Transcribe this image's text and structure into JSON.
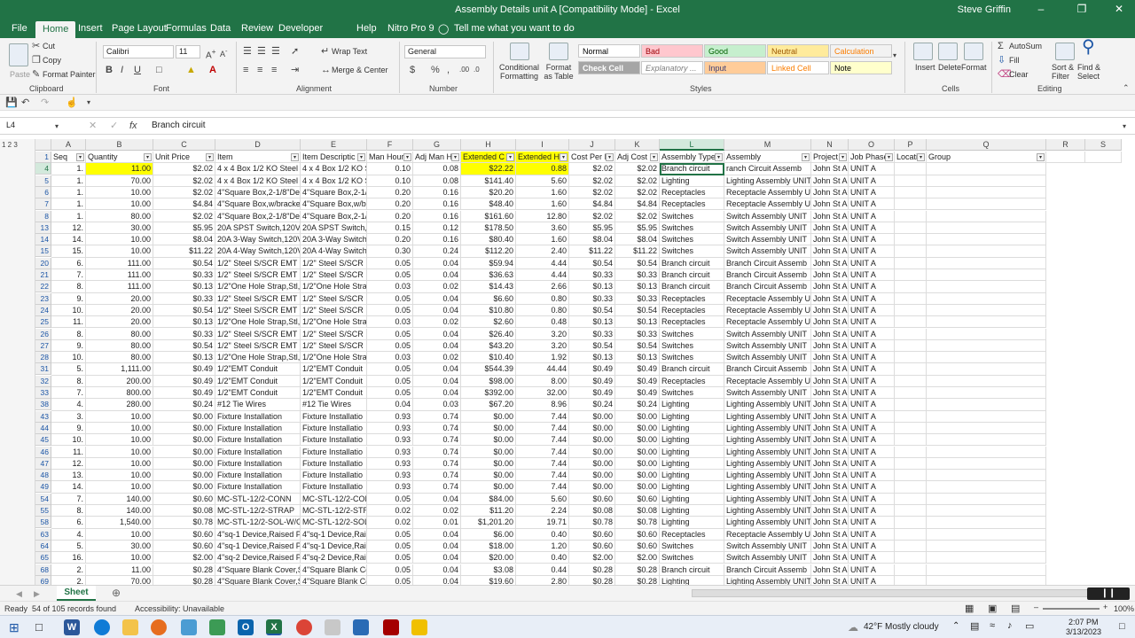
{
  "window": {
    "title": "Assembly Details unit A  [Compatibility Mode]  -  Excel",
    "user": "Steve Griffin"
  },
  "tabs": [
    "File",
    "Home",
    "Insert",
    "Page Layout",
    "Formulas",
    "Data",
    "Review",
    "Developer",
    "Help",
    "Nitro Pro 9"
  ],
  "tell_me": "Tell me what you want to do",
  "ribbon": {
    "clipboard": {
      "paste": "Paste",
      "cut": "Cut",
      "copy": "Copy",
      "format_painter": "Format Painter",
      "label": "Clipboard"
    },
    "font": {
      "name": "Calibri",
      "size": "11",
      "label": "Font"
    },
    "alignment": {
      "wrap": "Wrap Text",
      "merge": "Merge & Center",
      "label": "Alignment"
    },
    "number": {
      "format": "General",
      "label": "Number"
    },
    "styles": {
      "cond": "Conditional Formatting",
      "fmt_table": "Format as Table",
      "label": "Styles",
      "items": [
        {
          "name": "Normal",
          "bg": "#ffffff",
          "fg": "#000000"
        },
        {
          "name": "Bad",
          "bg": "#ffc7ce",
          "fg": "#9c0006"
        },
        {
          "name": "Good",
          "bg": "#c6efce",
          "fg": "#006100"
        },
        {
          "name": "Neutral",
          "bg": "#ffeb9c",
          "fg": "#9c5700"
        },
        {
          "name": "Calculation",
          "bg": "#f2f2f2",
          "fg": "#fa7d00"
        },
        {
          "name": "Check Cell",
          "bg": "#a5a5a5",
          "fg": "#ffffff"
        },
        {
          "name": "Explanatory ...",
          "bg": "#ffffff",
          "fg": "#7f7f7f"
        },
        {
          "name": "Input",
          "bg": "#ffcc99",
          "fg": "#3f3f76"
        },
        {
          "name": "Linked Cell",
          "bg": "#ffffff",
          "fg": "#fa7d00"
        },
        {
          "name": "Note",
          "bg": "#ffffcc",
          "fg": "#000000"
        }
      ]
    },
    "cells": {
      "insert": "Insert",
      "delete": "Delete",
      "format": "Format",
      "label": "Cells"
    },
    "editing": {
      "autosum": "AutoSum",
      "fill": "Fill",
      "clear": "Clear",
      "sort": "Sort & Filter",
      "find": "Find & Select",
      "label": "Editing"
    }
  },
  "formula_bar": {
    "name_box": "L4",
    "content": "Branch circuit"
  },
  "columns": [
    "A",
    "B",
    "C",
    "D",
    "E",
    "F",
    "G",
    "H",
    "I",
    "J",
    "K",
    "L",
    "M",
    "N",
    "O",
    "P",
    "Q",
    "R",
    "S"
  ],
  "headers": [
    "Seq",
    "Quantity",
    "Unit Price",
    "Item",
    "Item Descriptic",
    "Man Hour",
    "Adj Man H",
    "Extended C",
    "Extended H",
    "Cost Per I",
    "Adj Cost I",
    "Assembly Type",
    "Assembly",
    "Project",
    "Job Phase",
    "Locati",
    "Group"
  ],
  "rows": [
    [
      "4",
      "1.",
      "11.00",
      "$2.02",
      "4 x 4 Box 1/2 KO  Steel",
      "4 x 4 Box 1/2 KO  S",
      "0.10",
      "0.08",
      "$22.22",
      "0.88",
      "$2.02",
      "$2.02",
      "Branch circuit",
      "ranch Circuit Assemb",
      "John St A",
      "UNIT A"
    ],
    [
      "5",
      "1.",
      "70.00",
      "$2.02",
      "4 x 4 Box 1/2 KO  Steel",
      "4 x 4 Box 1/2 KO  S",
      "0.10",
      "0.08",
      "$141.40",
      "5.60",
      "$2.02",
      "$2.02",
      "Lighting",
      "Lighting Assembly UNIT",
      "John St A",
      "UNIT A"
    ],
    [
      "6",
      "1.",
      "10.00",
      "$2.02",
      "4\"Square Box,2-1/8\"De",
      "4\"Square Box,2-1/",
      "0.20",
      "0.16",
      "$20.20",
      "1.60",
      "$2.02",
      "$2.02",
      "Receptacles",
      "Receptacle Assembly U",
      "John St A",
      "UNIT A"
    ],
    [
      "7",
      "1.",
      "10.00",
      "$4.84",
      "4\"Square Box,w/bracke",
      "4\"Square Box,w/b",
      "0.20",
      "0.16",
      "$48.40",
      "1.60",
      "$4.84",
      "$4.84",
      "Receptacles",
      "Receptacle Assembly U",
      "John St A",
      "UNIT A"
    ],
    [
      "8",
      "1.",
      "80.00",
      "$2.02",
      "4\"Square Box,2-1/8\"De",
      "4\"Square Box,2-1/",
      "0.20",
      "0.16",
      "$161.60",
      "12.80",
      "$2.02",
      "$2.02",
      "Switches",
      "Switch Assembly UNIT",
      "John St A",
      "UNIT A"
    ],
    [
      "13",
      "12.",
      "30.00",
      "$5.95",
      "20A SPST Switch,120V-",
      "20A SPST Switch,1",
      "0.15",
      "0.12",
      "$178.50",
      "3.60",
      "$5.95",
      "$5.95",
      "Switches",
      "Switch Assembly UNIT",
      "John St A",
      "UNIT A"
    ],
    [
      "14",
      "14.",
      "10.00",
      "$8.04",
      "20A 3-Way Switch,120V",
      "20A 3-Way Switch",
      "0.20",
      "0.16",
      "$80.40",
      "1.60",
      "$8.04",
      "$8.04",
      "Switches",
      "Switch Assembly UNIT",
      "John St A",
      "UNIT A"
    ],
    [
      "15",
      "15.",
      "10.00",
      "$11.22",
      "20A 4-Way Switch,120V",
      "20A 4-Way Switch",
      "0.30",
      "0.24",
      "$112.20",
      "2.40",
      "$11.22",
      "$11.22",
      "Switches",
      "Switch Assembly UNIT",
      "John St A",
      "UNIT A"
    ],
    [
      "20",
      "6.",
      "111.00",
      "$0.54",
      "1/2\" Steel  S/SCR EMT C",
      "1/2\" Steel  S/SCR E",
      "0.05",
      "0.04",
      "$59.94",
      "4.44",
      "$0.54",
      "$0.54",
      "Branch circuit",
      "Branch Circuit Assemb",
      "John St A",
      "UNIT A"
    ],
    [
      "21",
      "7.",
      "111.00",
      "$0.33",
      "1/2\" Steel  S/SCR EMT C",
      "1/2\" Steel  S/SCR E",
      "0.05",
      "0.04",
      "$36.63",
      "4.44",
      "$0.33",
      "$0.33",
      "Branch circuit",
      "Branch Circuit Assemb",
      "John St A",
      "UNIT A"
    ],
    [
      "22",
      "8.",
      "111.00",
      "$0.13",
      "1/2\"One Hole Strap,Stl,",
      "1/2\"One Hole Stra",
      "0.03",
      "0.02",
      "$14.43",
      "2.66",
      "$0.13",
      "$0.13",
      "Branch circuit",
      "Branch Circuit Assemb",
      "John St A",
      "UNIT A"
    ],
    [
      "23",
      "9.",
      "20.00",
      "$0.33",
      "1/2\" Steel  S/SCR EMT C",
      "1/2\" Steel  S/SCR E",
      "0.05",
      "0.04",
      "$6.60",
      "0.80",
      "$0.33",
      "$0.33",
      "Receptacles",
      "Receptacle Assembly U",
      "John St A",
      "UNIT A"
    ],
    [
      "24",
      "10.",
      "20.00",
      "$0.54",
      "1/2\" Steel  S/SCR EMT C",
      "1/2\" Steel  S/SCR E",
      "0.05",
      "0.04",
      "$10.80",
      "0.80",
      "$0.54",
      "$0.54",
      "Receptacles",
      "Receptacle Assembly U",
      "John St A",
      "UNIT A"
    ],
    [
      "25",
      "11.",
      "20.00",
      "$0.13",
      "1/2\"One Hole Strap,Stl,",
      "1/2\"One Hole Stra",
      "0.03",
      "0.02",
      "$2.60",
      "0.48",
      "$0.13",
      "$0.13",
      "Receptacles",
      "Receptacle Assembly U",
      "John St A",
      "UNIT A"
    ],
    [
      "26",
      "8.",
      "80.00",
      "$0.33",
      "1/2\" Steel  S/SCR EMT C",
      "1/2\" Steel  S/SCR E",
      "0.05",
      "0.04",
      "$26.40",
      "3.20",
      "$0.33",
      "$0.33",
      "Switches",
      "Switch Assembly UNIT",
      "John St A",
      "UNIT A"
    ],
    [
      "27",
      "9.",
      "80.00",
      "$0.54",
      "1/2\" Steel  S/SCR EMT C",
      "1/2\" Steel  S/SCR E",
      "0.05",
      "0.04",
      "$43.20",
      "3.20",
      "$0.54",
      "$0.54",
      "Switches",
      "Switch Assembly UNIT",
      "John St A",
      "UNIT A"
    ],
    [
      "28",
      "10.",
      "80.00",
      "$0.13",
      "1/2\"One Hole Strap,Stl,",
      "1/2\"One Hole Stra",
      "0.03",
      "0.02",
      "$10.40",
      "1.92",
      "$0.13",
      "$0.13",
      "Switches",
      "Switch Assembly UNIT",
      "John St A",
      "UNIT A"
    ],
    [
      "31",
      "5.",
      "1,111.00",
      "$0.49",
      "1/2\"EMT Conduit",
      "1/2\"EMT Conduit",
      "0.05",
      "0.04",
      "$544.39",
      "44.44",
      "$0.49",
      "$0.49",
      "Branch circuit",
      "Branch Circuit Assemb",
      "John St A",
      "UNIT A"
    ],
    [
      "32",
      "8.",
      "200.00",
      "$0.49",
      "1/2\"EMT Conduit",
      "1/2\"EMT Conduit",
      "0.05",
      "0.04",
      "$98.00",
      "8.00",
      "$0.49",
      "$0.49",
      "Receptacles",
      "Receptacle Assembly U",
      "John St A",
      "UNIT A"
    ],
    [
      "33",
      "7.",
      "800.00",
      "$0.49",
      "1/2\"EMT Conduit",
      "1/2\"EMT Conduit",
      "0.05",
      "0.04",
      "$392.00",
      "32.00",
      "$0.49",
      "$0.49",
      "Switches",
      "Switch Assembly UNIT",
      "John St A",
      "UNIT A"
    ],
    [
      "38",
      "4.",
      "280.00",
      "$0.24",
      "#12 Tie Wires",
      "#12 Tie Wires",
      "0.04",
      "0.03",
      "$67.20",
      "8.96",
      "$0.24",
      "$0.24",
      "Lighting",
      "Lighting Assembly UNIT",
      "John St A",
      "UNIT A"
    ],
    [
      "43",
      "3.",
      "10.00",
      "$0.00",
      "Fixture Installation",
      "Fixture Installatio",
      "0.93",
      "0.74",
      "$0.00",
      "7.44",
      "$0.00",
      "$0.00",
      "Lighting",
      "Lighting Assembly UNIT",
      "John St A",
      "UNIT A"
    ],
    [
      "44",
      "9.",
      "10.00",
      "$0.00",
      "Fixture Installation",
      "Fixture Installatio",
      "0.93",
      "0.74",
      "$0.00",
      "7.44",
      "$0.00",
      "$0.00",
      "Lighting",
      "Lighting Assembly UNIT",
      "John St A",
      "UNIT A"
    ],
    [
      "45",
      "10.",
      "10.00",
      "$0.00",
      "Fixture Installation",
      "Fixture Installatio",
      "0.93",
      "0.74",
      "$0.00",
      "7.44",
      "$0.00",
      "$0.00",
      "Lighting",
      "Lighting Assembly UNIT",
      "John St A",
      "UNIT A"
    ],
    [
      "46",
      "11.",
      "10.00",
      "$0.00",
      "Fixture Installation",
      "Fixture Installatio",
      "0.93",
      "0.74",
      "$0.00",
      "7.44",
      "$0.00",
      "$0.00",
      "Lighting",
      "Lighting Assembly UNIT",
      "John St A",
      "UNIT A"
    ],
    [
      "47",
      "12.",
      "10.00",
      "$0.00",
      "Fixture Installation",
      "Fixture Installatio",
      "0.93",
      "0.74",
      "$0.00",
      "7.44",
      "$0.00",
      "$0.00",
      "Lighting",
      "Lighting Assembly UNIT",
      "John St A",
      "UNIT A"
    ],
    [
      "48",
      "13.",
      "10.00",
      "$0.00",
      "Fixture Installation",
      "Fixture Installatio",
      "0.93",
      "0.74",
      "$0.00",
      "7.44",
      "$0.00",
      "$0.00",
      "Lighting",
      "Lighting Assembly UNIT",
      "John St A",
      "UNIT A"
    ],
    [
      "49",
      "14.",
      "10.00",
      "$0.00",
      "Fixture Installation",
      "Fixture Installatio",
      "0.93",
      "0.74",
      "$0.00",
      "7.44",
      "$0.00",
      "$0.00",
      "Lighting",
      "Lighting Assembly UNIT",
      "John St A",
      "UNIT A"
    ],
    [
      "54",
      "7.",
      "140.00",
      "$0.60",
      "MC-STL-12/2-CONN",
      "MC-STL-12/2-CON",
      "0.05",
      "0.04",
      "$84.00",
      "5.60",
      "$0.60",
      "$0.60",
      "Lighting",
      "Lighting Assembly UNIT",
      "John St A",
      "UNIT A"
    ],
    [
      "55",
      "8.",
      "140.00",
      "$0.08",
      "MC-STL-12/2-STRAP",
      "MC-STL-12/2-STRA",
      "0.02",
      "0.02",
      "$11.20",
      "2.24",
      "$0.08",
      "$0.08",
      "Lighting",
      "Lighting Assembly UNIT",
      "John St A",
      "UNIT A"
    ],
    [
      "58",
      "6.",
      "1,540.00",
      "$0.78",
      "MC-STL-12/2-SOL-W/GF",
      "MC-STL-12/2-SOL-",
      "0.02",
      "0.01",
      "$1,201.20",
      "19.71",
      "$0.78",
      "$0.78",
      "Lighting",
      "Lighting Assembly UNIT",
      "John St A",
      "UNIT A"
    ],
    [
      "63",
      "4.",
      "10.00",
      "$0.60",
      "4\"sq-1 Device,Raised P",
      "4\"sq-1 Device,Rai",
      "0.05",
      "0.04",
      "$6.00",
      "0.40",
      "$0.60",
      "$0.60",
      "Receptacles",
      "Receptacle Assembly U",
      "John St A",
      "UNIT A"
    ],
    [
      "64",
      "5.",
      "30.00",
      "$0.60",
      "4\"sq-1 Device,Raised P",
      "4\"sq-1 Device,Rai",
      "0.05",
      "0.04",
      "$18.00",
      "1.20",
      "$0.60",
      "$0.60",
      "Switches",
      "Switch Assembly UNIT",
      "John St A",
      "UNIT A"
    ],
    [
      "65",
      "16.",
      "10.00",
      "$2.00",
      "4\"sq-2 Device,Raised P",
      "4\"sq-2 Device,Rai",
      "0.05",
      "0.04",
      "$20.00",
      "0.40",
      "$2.00",
      "$2.00",
      "Switches",
      "Switch Assembly UNIT",
      "John St A",
      "UNIT A"
    ],
    [
      "68",
      "2.",
      "11.00",
      "$0.28",
      "4\"Square Blank Cover,S",
      "4\"Square Blank Co",
      "0.05",
      "0.04",
      "$3.08",
      "0.44",
      "$0.28",
      "$0.28",
      "Branch circuit",
      "Branch Circuit Assemb",
      "John St A",
      "UNIT A"
    ],
    [
      "69",
      "2.",
      "70.00",
      "$0.28",
      "4\"Square Blank Cover,S",
      "4\"Square Blank Co",
      "0.05",
      "0.04",
      "$19.60",
      "2.80",
      "$0.28",
      "$0.28",
      "Lighting",
      "Lighting Assembly UNIT",
      "John St A",
      "UNIT A"
    ]
  ],
  "sheet_tab": "Sheet",
  "status": {
    "ready": "Ready",
    "records": "54 of 105 records found",
    "accessibility": "Accessibility: Unavailable",
    "zoom": "100%"
  },
  "taskbar": {
    "weather": "42°F  Mostly cloudy",
    "time": "2:07 PM",
    "date": "3/13/2023"
  }
}
